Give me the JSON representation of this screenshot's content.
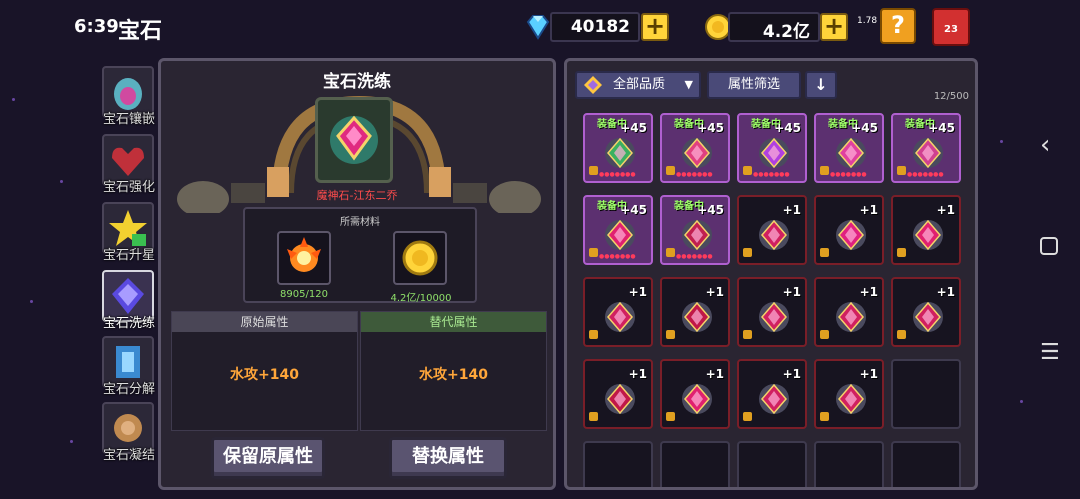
{
  "status": {
    "clock": "6:39",
    "network": "1.78 KB/s",
    "battery": "23"
  },
  "header": {
    "title": "宝石"
  },
  "resources": {
    "diamonds": "40182",
    "coins": "4.2亿"
  },
  "side_tabs": [
    {
      "label": "宝石镶嵌"
    },
    {
      "label": "宝石强化"
    },
    {
      "label": "宝石升星"
    },
    {
      "label": "宝石洗练"
    },
    {
      "label": "宝石分解"
    },
    {
      "label": "宝石凝结"
    }
  ],
  "center": {
    "title": "宝石洗练",
    "gem_name": "魔神石-江东二乔",
    "materials_title": "所需材料",
    "materials": [
      {
        "icon": "fire-essence-icon",
        "count": "8905/120"
      },
      {
        "icon": "gold-coin-icon",
        "count": "4.2亿/10000"
      }
    ],
    "original_header": "原始属性",
    "replace_header": "替代属性",
    "original_value": "水攻+140",
    "replace_value": "水攻+140",
    "keep_button": "保留原属性",
    "replace_button": "替换属性"
  },
  "inventory": {
    "filter_quality": "全部品质",
    "filter_attr": "属性筛选",
    "count": "12/500",
    "equipped_label": "装备中",
    "items": [
      {
        "level": "+45",
        "equipped": true,
        "color": "#3ab060"
      },
      {
        "level": "+45",
        "equipped": true,
        "color": "#e04080"
      },
      {
        "level": "+45",
        "equipped": true,
        "color": "#b040e0"
      },
      {
        "level": "+45",
        "equipped": true,
        "color": "#e040a0"
      },
      {
        "level": "+45",
        "equipped": true,
        "color": "#d04090"
      },
      {
        "level": "+45",
        "equipped": true,
        "color": "#e02070"
      },
      {
        "level": "+45",
        "equipped": true,
        "color": "#c02050"
      },
      {
        "level": "+1",
        "equipped": false,
        "color": "#d02060"
      },
      {
        "level": "+1",
        "equipped": false,
        "color": "#e02080"
      },
      {
        "level": "+1",
        "equipped": false,
        "color": "#e02070"
      },
      {
        "level": "+1",
        "equipped": false,
        "color": "#d02060"
      },
      {
        "level": "+1",
        "equipped": false,
        "color": "#c01848"
      },
      {
        "level": "+1",
        "equipped": false,
        "color": "#d02060"
      },
      {
        "level": "+1",
        "equipped": false,
        "color": "#d02060"
      },
      {
        "level": "+1",
        "equipped": false,
        "color": "#d02060"
      },
      {
        "level": "+1",
        "equipped": false,
        "color": "#c01848"
      },
      {
        "level": "+1",
        "equipped": false,
        "color": "#e02070"
      },
      {
        "level": "+1",
        "equipped": false,
        "color": "#d02060"
      },
      {
        "level": "+1",
        "equipped": false,
        "color": "#d02060"
      }
    ]
  }
}
